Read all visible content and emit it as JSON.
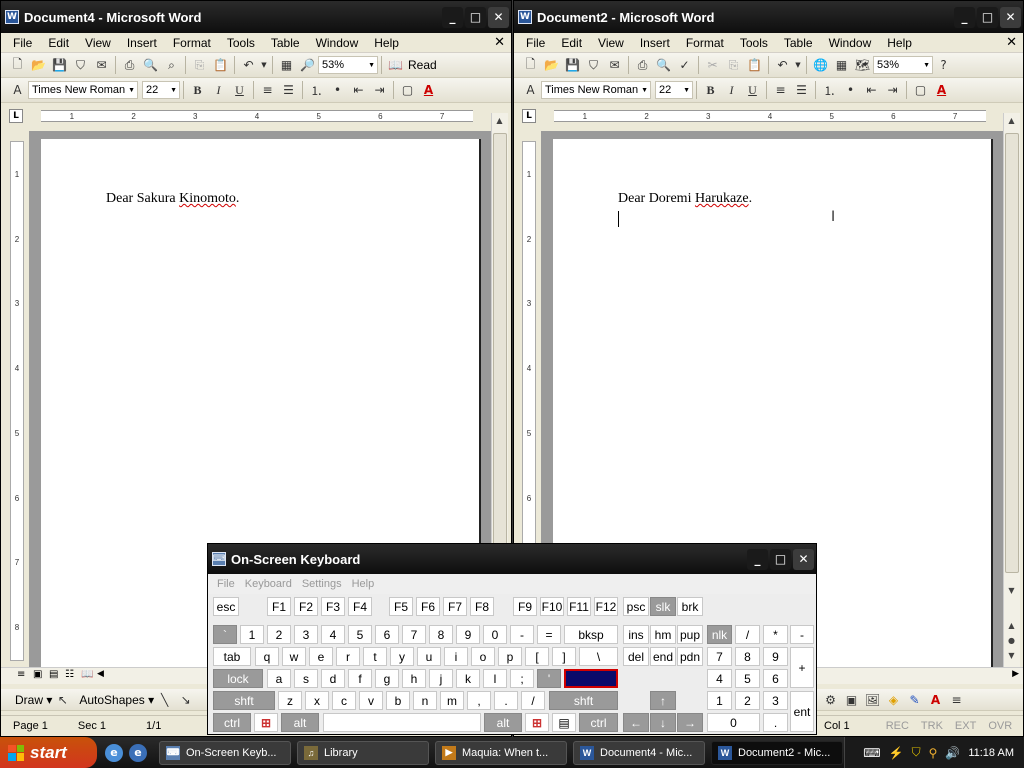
{
  "left_window": {
    "title": "Document4 - Microsoft Word",
    "menu": [
      "File",
      "Edit",
      "View",
      "Insert",
      "Format",
      "Tools",
      "Table",
      "Window",
      "Help"
    ],
    "zoom": "53%",
    "read_label": "Read",
    "font_name": "Times New Roman",
    "font_size": "22",
    "doc_text_prefix": "Dear Sakura ",
    "doc_text_squiggle": "Kinomoto",
    "doc_text_suffix": ".",
    "ruler_numbers": [
      "1",
      "2",
      "3",
      "4",
      "5",
      "6",
      "7"
    ],
    "status": {
      "page": "Page  1",
      "sec": "Sec  1",
      "pages": "1/1"
    },
    "draw_label": "Draw ▾",
    "autoshapes_label": "AutoShapes ▾"
  },
  "right_window": {
    "title": "Document2 - Microsoft Word",
    "menu": [
      "File",
      "Edit",
      "View",
      "Insert",
      "Format",
      "Tools",
      "Table",
      "Window",
      "Help"
    ],
    "zoom": "53%",
    "font_name": "Times New Roman",
    "font_size": "22",
    "doc_text_prefix": "Dear Doremi ",
    "doc_text_squiggle": "Harukaze",
    "doc_text_suffix": ".",
    "ruler_numbers": [
      "1",
      "2",
      "3",
      "4",
      "5",
      "6",
      "7"
    ],
    "status": {
      "col": "Col  1",
      "rec": "REC",
      "trk": "TRK",
      "ext": "EXT",
      "ovr": "OVR"
    }
  },
  "osk": {
    "title": "On-Screen Keyboard",
    "menu": [
      "File",
      "Keyboard",
      "Settings",
      "Help"
    ],
    "keys": {
      "esc": "esc",
      "f1": "F1",
      "f2": "F2",
      "f3": "F3",
      "f4": "F4",
      "f5": "F5",
      "f6": "F6",
      "f7": "F7",
      "f8": "F8",
      "f9": "F9",
      "f10": "F10",
      "f11": "F11",
      "f12": "F12",
      "psc": "psc",
      "slk": "slk",
      "brk": "brk",
      "backtick": "`",
      "n1": "1",
      "n2": "2",
      "n3": "3",
      "n4": "4",
      "n5": "5",
      "n6": "6",
      "n7": "7",
      "n8": "8",
      "n9": "9",
      "n0": "0",
      "minus": "-",
      "equal": "=",
      "bksp": "bksp",
      "ins": "ins",
      "hm": "hm",
      "pup": "pup",
      "nlk": "nlk",
      "kdiv": "/",
      "kmul": "*",
      "ksub": "-",
      "tab": "tab",
      "q": "q",
      "w": "w",
      "e": "e",
      "r": "r",
      "t": "t",
      "y": "y",
      "u": "u",
      "i": "i",
      "o": "o",
      "p": "p",
      "lbr": "[",
      "rbr": "]",
      "bslash": "\\",
      "del": "del",
      "end": "end",
      "pdn": "pdn",
      "k7": "7",
      "k8": "8",
      "k9": "9",
      "kadd": "+",
      "lock": "lock",
      "a": "a",
      "s": "s",
      "d": "d",
      "f": "f",
      "g": "g",
      "h": "h",
      "j": "j",
      "k": "k",
      "l": "l",
      "semi": ";",
      "quote": "'",
      "k4": "4",
      "k5": "5",
      "k6": "6",
      "shft": "shft",
      "z": "z",
      "x": "x",
      "c": "c",
      "v": "v",
      "b": "b",
      "n": "n",
      "m": "m",
      "comma": ",",
      "period": ".",
      "slash": "/",
      "shft2": "shft",
      "up": "↑",
      "k1": "1",
      "k2": "2",
      "k3": "3",
      "kent": "ent",
      "ctrl": "ctrl",
      "alt": "alt",
      "alt2": "alt",
      "ctrl2": "ctrl",
      "left": "←",
      "down": "↓",
      "right": "→",
      "k0": "0",
      "kdot": "."
    }
  },
  "taskbar": {
    "start": "start",
    "tasks": [
      "On-Screen Keyb...",
      "Library",
      "Maquia: When t...",
      "Document4 - Mic...",
      "Document2 - Mic..."
    ],
    "clock": "11:18 AM"
  },
  "colors": {
    "title_bar": "#1a1a1a",
    "start": "#d2351e",
    "osk_selected": "#0a0a6a"
  }
}
